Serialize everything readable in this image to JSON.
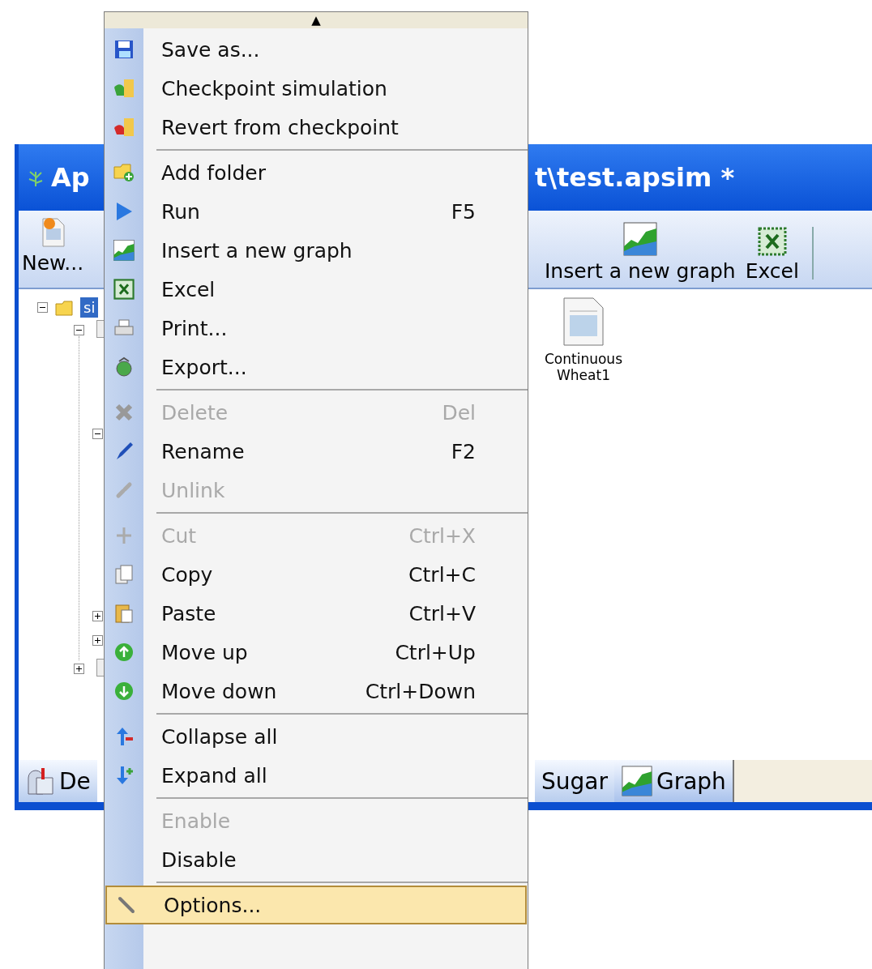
{
  "window": {
    "title_left": "Ap",
    "title_right": "t\\test.apsim *"
  },
  "toolbar": {
    "left": [
      {
        "label": "New..."
      }
    ],
    "right": [
      {
        "label": "Insert a new graph"
      },
      {
        "label": "Excel"
      }
    ]
  },
  "tree": [
    {
      "label": "si",
      "selected": true,
      "expanded": true,
      "children": [
        {
          "expanded": true,
          "children": [
            {
              "expanded": true
            },
            {
              "expanded": false
            },
            {
              "expanded": false
            }
          ]
        },
        {
          "expanded": false
        }
      ]
    }
  ],
  "content": [
    {
      "label": "Continuous Wheat1"
    }
  ],
  "bottom_tabs": [
    {
      "label": "De",
      "selected": false
    },
    {
      "label": "Sugar",
      "selected": false
    },
    {
      "label": "Graph",
      "selected": true
    }
  ],
  "menu": {
    "scroll_up": "▲",
    "items": [
      {
        "kind": "item",
        "label": "Save as...",
        "disabled": false,
        "selected": false
      },
      {
        "kind": "item",
        "label": "Checkpoint simulation",
        "disabled": false,
        "selected": false
      },
      {
        "kind": "item",
        "label": "Revert from checkpoint",
        "disabled": false,
        "selected": false
      },
      {
        "kind": "separator"
      },
      {
        "kind": "item",
        "label": "Add folder",
        "disabled": false,
        "selected": false
      },
      {
        "kind": "item",
        "label": "Run",
        "shortcut": "F5",
        "disabled": false,
        "selected": false
      },
      {
        "kind": "item",
        "label": "Insert a new graph",
        "disabled": false,
        "selected": false
      },
      {
        "kind": "item",
        "label": "Excel",
        "disabled": false,
        "selected": false
      },
      {
        "kind": "item",
        "label": "Print...",
        "disabled": false,
        "selected": false
      },
      {
        "kind": "item",
        "label": "Export...",
        "disabled": false,
        "selected": false
      },
      {
        "kind": "separator"
      },
      {
        "kind": "item",
        "label": "Delete",
        "shortcut": "Del",
        "disabled": true,
        "selected": false
      },
      {
        "kind": "item",
        "label": "Rename",
        "shortcut": "F2",
        "disabled": false,
        "selected": false
      },
      {
        "kind": "item",
        "label": "Unlink",
        "disabled": true,
        "selected": false
      },
      {
        "kind": "separator"
      },
      {
        "kind": "item",
        "label": "Cut",
        "shortcut": "Ctrl+X",
        "disabled": true,
        "selected": false
      },
      {
        "kind": "item",
        "label": "Copy",
        "shortcut": "Ctrl+C",
        "disabled": false,
        "selected": false
      },
      {
        "kind": "item",
        "label": "Paste",
        "shortcut": "Ctrl+V",
        "disabled": false,
        "selected": false
      },
      {
        "kind": "item",
        "label": "Move up",
        "shortcut": "Ctrl+Up",
        "disabled": false,
        "selected": false
      },
      {
        "kind": "item",
        "label": "Move down",
        "shortcut": "Ctrl+Down",
        "disabled": false,
        "selected": false
      },
      {
        "kind": "separator"
      },
      {
        "kind": "item",
        "label": "Collapse all",
        "disabled": false,
        "selected": false
      },
      {
        "kind": "item",
        "label": "Expand all",
        "disabled": false,
        "selected": false
      },
      {
        "kind": "separator"
      },
      {
        "kind": "item",
        "label": "Enable",
        "disabled": true,
        "selected": false
      },
      {
        "kind": "item",
        "label": "Disable",
        "disabled": false,
        "selected": false
      },
      {
        "kind": "separator"
      },
      {
        "kind": "item",
        "label": "Options...",
        "disabled": false,
        "selected": true
      }
    ]
  }
}
